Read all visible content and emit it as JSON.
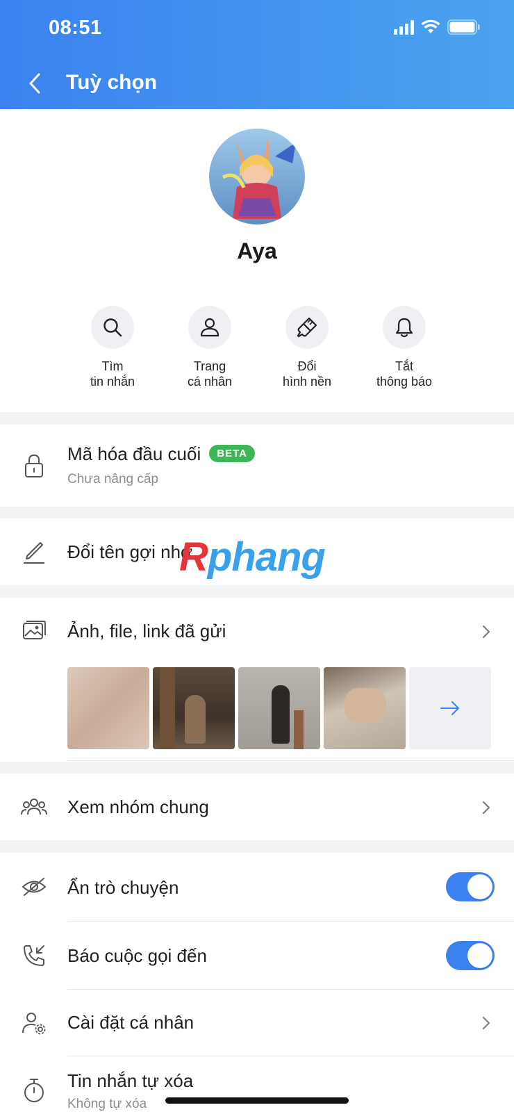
{
  "status_bar": {
    "time": "08:51"
  },
  "header": {
    "title": "Tuỳ chọn"
  },
  "profile": {
    "name": "Aya",
    "actions": [
      {
        "label": "Tìm\ntin nhắn",
        "icon": "search-icon"
      },
      {
        "label": "Trang\ncá nhân",
        "icon": "person-icon"
      },
      {
        "label": "Đổi\nhình nền",
        "icon": "paintbrush-icon"
      },
      {
        "label": "Tắt\nthông báo",
        "icon": "bell-icon"
      }
    ]
  },
  "encryption": {
    "title": "Mã hóa đầu cuối",
    "badge": "BETA",
    "subtitle": "Chưa nâng cấp"
  },
  "rename": {
    "title": "Đổi tên gợi nhớ"
  },
  "media": {
    "title": "Ảnh, file, link đã gửi"
  },
  "groups": {
    "title": "Xem nhóm chung"
  },
  "settings": {
    "hide_chat": {
      "title": "Ẩn trò chuyện",
      "on": true
    },
    "call_notify": {
      "title": "Báo cuộc gọi đến",
      "on": true
    },
    "personal": {
      "title": "Cài đặt cá nhân"
    },
    "auto_delete": {
      "title": "Tin nhắn tự xóa",
      "subtitle": "Không tự xóa"
    }
  },
  "watermark": {
    "r": "R",
    "rest": "phang"
  },
  "colors": {
    "accent": "#3b82f0",
    "beta": "#3db657"
  }
}
